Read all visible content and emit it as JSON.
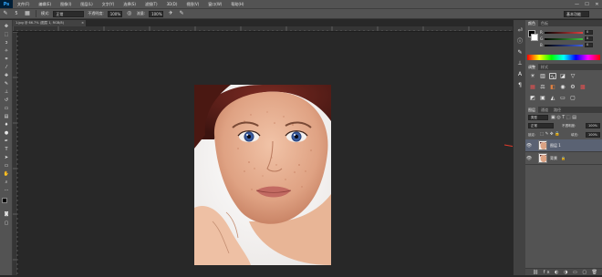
{
  "app": {
    "logo": "Ps"
  },
  "menubar": {
    "items": [
      "文件(F)",
      "编辑(E)",
      "图像(I)",
      "图层(L)",
      "文字(Y)",
      "选择(S)",
      "滤镜(T)",
      "3D(D)",
      "视图(V)",
      "窗口(W)",
      "帮助(H)"
    ],
    "window_controls": [
      "—",
      "☐",
      "✕"
    ]
  },
  "options": {
    "brush_size": "5",
    "mode_label": "模式:",
    "mode_value": "正常",
    "opacity_label": "不透明度:",
    "opacity_value": "100%",
    "flow_label": "流量:",
    "flow_value": "100%",
    "workspace": "基本功能"
  },
  "document": {
    "tab_title": "1.jpg @ 66.7% (图层 1, RGB/8)",
    "tab_close": "×"
  },
  "color_panel": {
    "tabs": [
      "颜色",
      "色板"
    ],
    "channels": [
      {
        "label": "R",
        "value": "0",
        "color": "#e04040"
      },
      {
        "label": "G",
        "value": "0",
        "color": "#40c040"
      },
      {
        "label": "B",
        "value": "0",
        "color": "#4060e0"
      }
    ]
  },
  "adjustments_panel": {
    "tabs": [
      "调整",
      "样式"
    ]
  },
  "layers_panel": {
    "tabs": [
      "图层",
      "通道",
      "路径"
    ],
    "kind_label": "类型",
    "blend_mode": "正常",
    "opacity_label": "不透明度:",
    "opacity_value": "100%",
    "lock_label": "锁定:",
    "fill_label": "填充:",
    "fill_value": "100%",
    "layers": [
      {
        "name": "图层 1",
        "selected": true,
        "visible": true
      },
      {
        "name": "背景",
        "selected": false,
        "visible": true,
        "locked": true
      }
    ]
  },
  "colors": {
    "accent_selected": "#5a6273",
    "arrow": "#e03a2a"
  }
}
